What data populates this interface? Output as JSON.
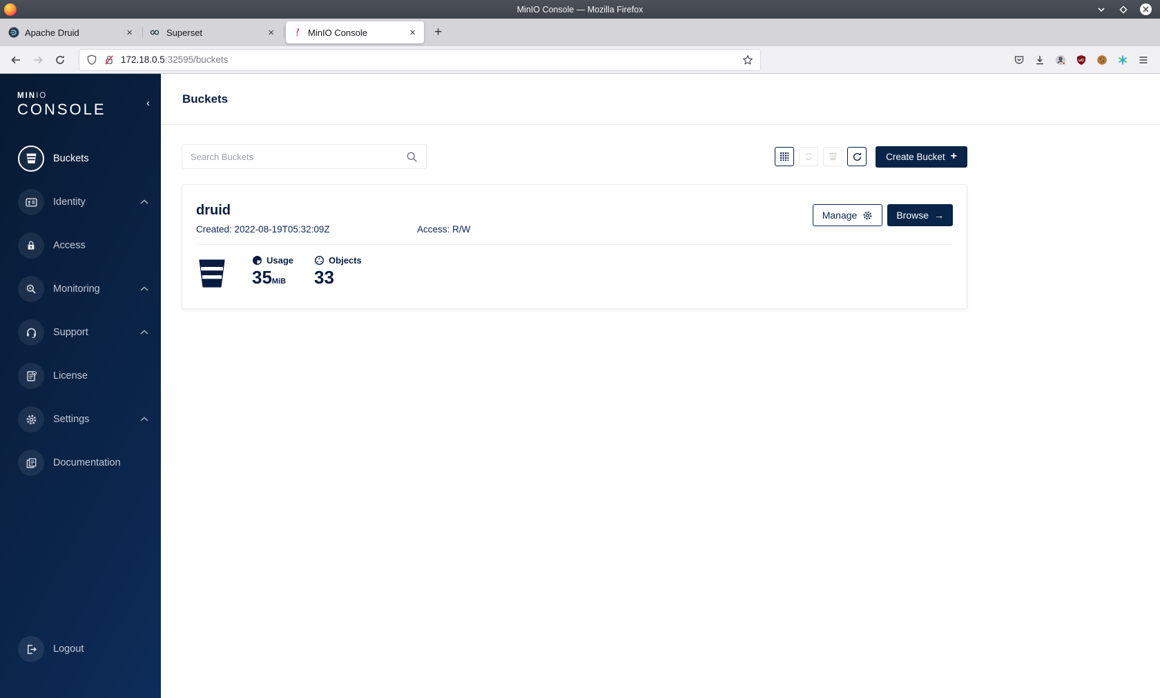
{
  "window": {
    "title": "MinIO Console — Mozilla Firefox"
  },
  "tabbar": {
    "close_glyph": "×",
    "new_tab_glyph": "+",
    "tabs": [
      {
        "label": "Apache Druid"
      },
      {
        "label": "Superset"
      },
      {
        "label": "MinIO Console"
      }
    ]
  },
  "toolbar": {
    "url": {
      "host": "172.18.0.5",
      "rest": ":32595/buckets"
    }
  },
  "sidebar": {
    "logo": {
      "min": "MIN",
      "io": "IO",
      "console": "CONSOLE"
    },
    "collapse_glyph": "‹",
    "items": [
      {
        "label": "Buckets"
      },
      {
        "label": "Identity"
      },
      {
        "label": "Access"
      },
      {
        "label": "Monitoring"
      },
      {
        "label": "Support"
      },
      {
        "label": "License"
      },
      {
        "label": "Settings"
      },
      {
        "label": "Documentation"
      }
    ],
    "logout_label": "Logout"
  },
  "page": {
    "title": "Buckets"
  },
  "content": {
    "search_placeholder": "Search Buckets",
    "create_button_label": "Create Bucket",
    "create_plus_glyph": "+"
  },
  "bucket": {
    "name": "druid",
    "created": "Created: 2022-08-19T05:32:09Z",
    "access": "Access: R/W",
    "manage_label": "Manage",
    "browse_label": "Browse",
    "browse_arrow": "→",
    "usage_label": "Usage",
    "usage_value": "35",
    "usage_unit": "MiB",
    "objects_label": "Objects",
    "objects_value": "33"
  },
  "colors": {
    "brand_navy": "#081c42",
    "sidebar_gradient_from": "#071a33",
    "sidebar_gradient_to": "#0e2d5a",
    "primary_button": "#082449",
    "disabled_icon": "#dcdcdc",
    "ublock_red": "#7c0b11",
    "flamingo_pink": "#e24a6c"
  }
}
